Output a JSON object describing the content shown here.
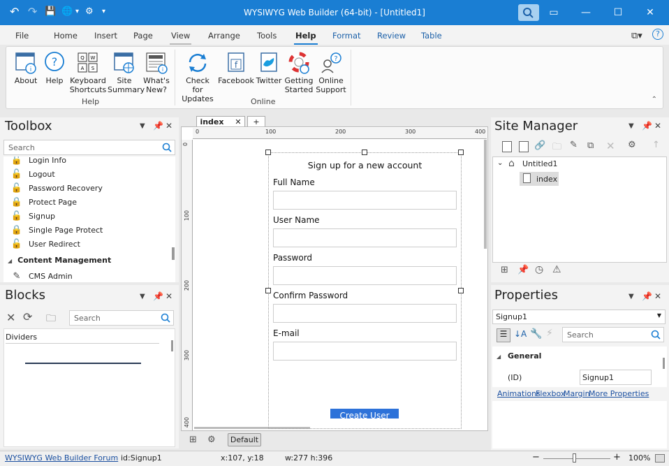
{
  "window": {
    "title": "WYSIWYG Web Builder (64-bit) - [Untitled1]",
    "min_glyph": "—",
    "max_glyph": "☐",
    "close_glyph": "✕"
  },
  "quick_access": {
    "undo": "↶",
    "redo": "↷",
    "save": "💾",
    "globe": "🌐",
    "more": "▾"
  },
  "ribbon_tabs": [
    "File",
    "Home",
    "Insert",
    "Page",
    "View",
    "Arrange",
    "Tools",
    "Help",
    "Format",
    "Review",
    "Table"
  ],
  "ribbon_groups": {
    "help": {
      "label": "Help",
      "buttons": [
        {
          "label": "About",
          "icon": "about-icon"
        },
        {
          "label": "Help",
          "icon": "help-icon"
        },
        {
          "label": "Keyboard Shortcuts",
          "icon": "keyboard-icon"
        },
        {
          "label": "Site Summary",
          "icon": "site-summary-icon"
        },
        {
          "label": "What's New?",
          "icon": "news-icon"
        }
      ]
    },
    "online": {
      "label": "Online",
      "buttons": [
        {
          "label": "Check for Updates",
          "icon": "refresh-icon"
        },
        {
          "label": "Facebook",
          "icon": "facebook-icon"
        },
        {
          "label": "Twitter",
          "icon": "twitter-icon"
        },
        {
          "label": "Getting Started",
          "icon": "lifebuoy-icon"
        },
        {
          "label": "Online Support",
          "icon": "support-icon"
        }
      ]
    }
  },
  "toolbox": {
    "title": "Toolbox",
    "search_placeholder": "Search",
    "items": [
      "Login Info",
      "Logout",
      "Password Recovery",
      "Protect Page",
      "Signup",
      "Single Page Protect",
      "User Redirect"
    ],
    "section": "Content Management",
    "last_item": "CMS Admin"
  },
  "blocks": {
    "title": "Blocks",
    "search_placeholder": "Search",
    "category": "Dividers"
  },
  "editor": {
    "tab": "index",
    "add_tab": "+",
    "ruler_h": [
      "0",
      "100",
      "200",
      "300",
      "400"
    ],
    "ruler_v": [
      "0",
      "100",
      "200",
      "300",
      "400"
    ],
    "default_button": "Default",
    "form": {
      "heading": "Sign up for a new account",
      "fields": [
        "Full Name",
        "User Name",
        "Password",
        "Confirm Password",
        "E-mail"
      ],
      "submit": "Create User"
    }
  },
  "site_manager": {
    "title": "Site Manager",
    "root": "Untitled1",
    "page": "index"
  },
  "properties": {
    "title": "Properties",
    "selected": "Signup1",
    "search_placeholder": "Search",
    "section": "General",
    "id_label": "(ID)",
    "id_value": "Signup1",
    "links": [
      "Animations",
      "Flexbox",
      "Margin",
      "More Properties"
    ]
  },
  "status": {
    "forum": "WYSIWYG Web Builder Forum",
    "id": "id:Signup1",
    "pos": "x:107, y:18",
    "size": "w:277 h:396",
    "zoom": "100%"
  },
  "colors": {
    "accent": "#1a7ed3",
    "button": "#2d72d9"
  }
}
